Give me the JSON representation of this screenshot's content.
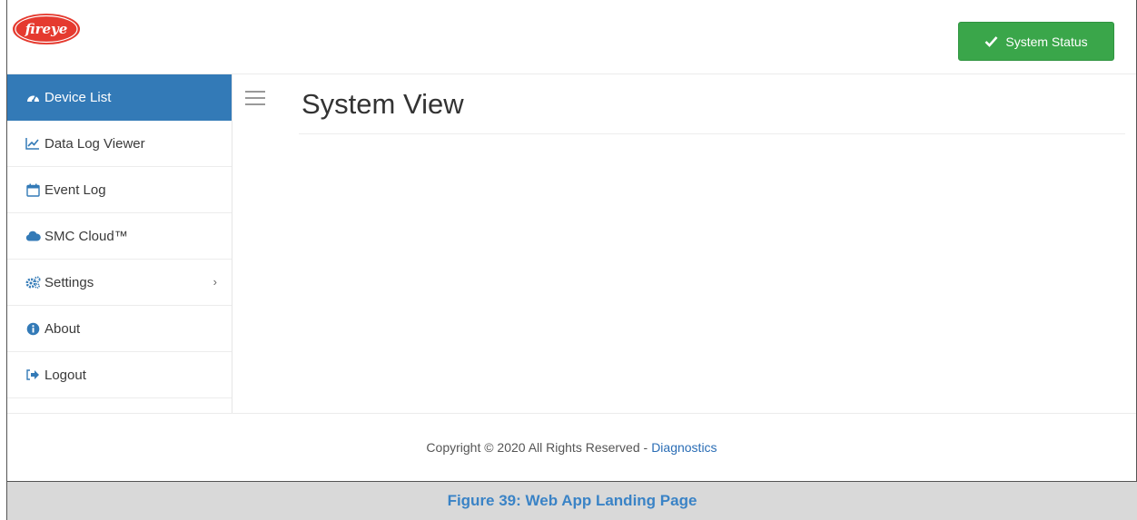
{
  "header": {
    "logo_text": "fireye",
    "status_button_label": "System Status",
    "status_button_icon": "check-icon",
    "status_color": "#3aa64a",
    "logo_color": "#e53a2f"
  },
  "sidebar": {
    "active_color": "#337ab7",
    "items": [
      {
        "label": "Device List",
        "icon": "tachometer-icon",
        "active": true
      },
      {
        "label": "Data Log Viewer",
        "icon": "line-chart-icon"
      },
      {
        "label": "Event Log",
        "icon": "calendar-icon"
      },
      {
        "label": "SMC Cloud™",
        "icon": "cloud-icon"
      },
      {
        "label": "Settings",
        "icon": "cogs-icon",
        "has_submenu": true,
        "submenu_icon": "chevron-right-icon"
      },
      {
        "label": "About",
        "icon": "info-icon"
      },
      {
        "label": "Logout",
        "icon": "sign-out-icon"
      }
    ]
  },
  "main": {
    "title": "System View",
    "menu_icon": "hamburger-icon"
  },
  "footer": {
    "copyright": "Copyright © 2020 All Rights Reserved -",
    "link_label": "Diagnostics"
  },
  "caption": {
    "text": "Figure 39: Web App Landing Page"
  }
}
